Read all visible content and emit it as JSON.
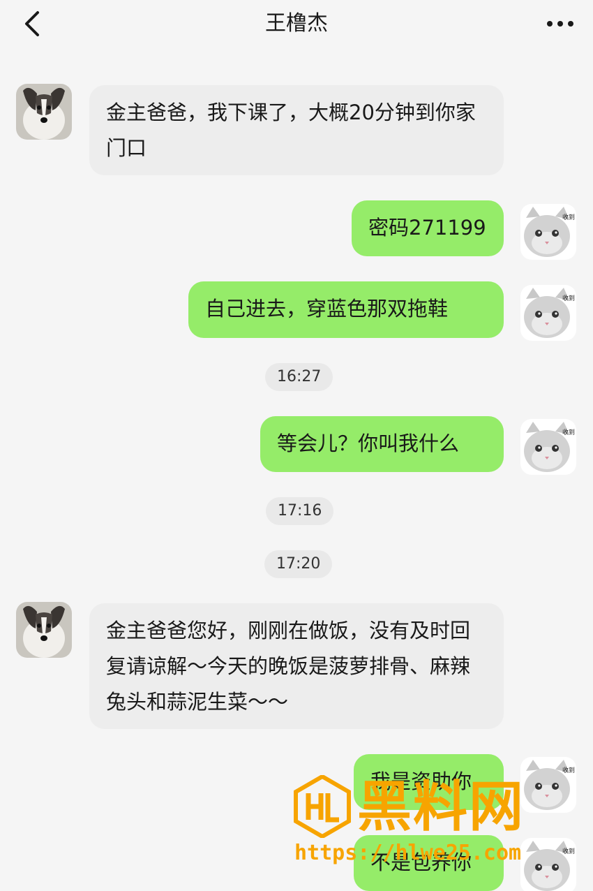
{
  "header": {
    "title": "王橹杰",
    "back_icon": "chevron-left-icon",
    "more_icon": "more-horizontal-icon"
  },
  "messages": [
    {
      "side": "in",
      "text": "金主爸爸，我下课了，大概20分钟到你家门口"
    },
    {
      "side": "out",
      "text": "密码271199"
    },
    {
      "side": "out",
      "text": "自己进去，穿蓝色那双拖鞋"
    },
    {
      "type": "time",
      "text": "16:27"
    },
    {
      "side": "out",
      "text": "等会儿？你叫我什么"
    },
    {
      "type": "time",
      "text": "17:16"
    },
    {
      "type": "time",
      "text": "17:20"
    },
    {
      "side": "in",
      "text": "金主爸爸您好，刚刚在做饭，没有及时回复请谅解～今天的晚饭是菠萝排骨、麻辣兔头和蒜泥生菜～～"
    },
    {
      "side": "out",
      "text": "我是资助你"
    },
    {
      "side": "out",
      "text": "不是包养你"
    }
  ],
  "sticker_caption": "收到",
  "watermark": {
    "brand": "黑料网",
    "url": "https://hlwe25.com"
  },
  "colors": {
    "background": "#f5f5f5",
    "incoming_bubble": "#ededed",
    "outgoing_bubble": "#95ec69",
    "watermark": "#f7a400"
  }
}
